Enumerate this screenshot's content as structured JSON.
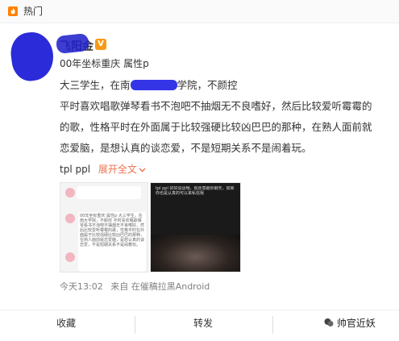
{
  "tag_bar": {
    "icon": "hot-topic-icon",
    "label": "热门"
  },
  "post": {
    "author_name": "飞阳金",
    "verified_badge": "V",
    "profile_line": "00年坐标重庆 属性p",
    "text_line1_a": "大三学生，在南",
    "text_line1_b": "学院，不颜控",
    "text_line2": "平时喜欢唱歌弹琴看书不泡吧不抽烟无不良嗜好，然后比较爱听霉霉的",
    "text_line3": "的歌，性格平时在外面属于比较强硬比较凶巴巴的那种，在熟人面前就",
    "text_line4": "恋爱脑，是想认真的谈恋爱，不是短期关系不是闹着玩。",
    "tags_text": "tpl ppl",
    "expand_label": "展开全文",
    "expand_icon": "chevron-down-icon",
    "timestamp": "今天13:02",
    "source": "来自 在催稿拉黑Android"
  },
  "images": {
    "thumb1_caption": "00年坐标重庆 属性p 大三学生，在南大学院，不颜控 平时喜欢唱歌弹琴看书不泡吧不抽烟无不良嗜好，然后比较爱听霉霉的歌，性格平时在外面属于比较强硬比较凶巴巴的那种，在熟人面前就恋爱脑，是想认真的谈恋爱，不是短期关系不是闹着玩。",
    "thumb2_caption": "tpl ppl 好好说话哦，很愿意跟你聊天，如果你也是认真的可以来私信我"
  },
  "actions": {
    "collect": "收藏",
    "repost": "转发",
    "watermark": "帅官近妖"
  }
}
